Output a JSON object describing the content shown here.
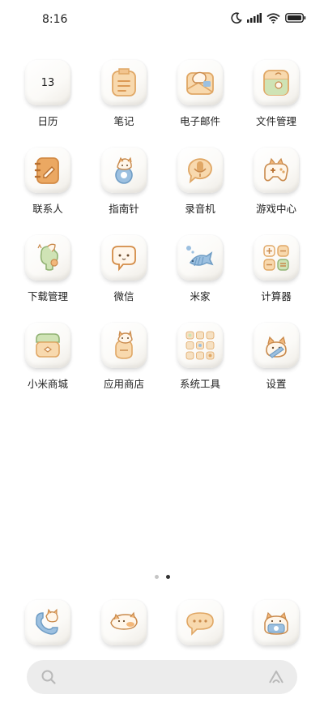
{
  "status_bar": {
    "time": "8:16",
    "icons": [
      "moon-icon",
      "signal-icon",
      "wifi-icon",
      "battery-icon"
    ]
  },
  "apps": [
    {
      "label": "日历",
      "icon": "calendar-icon",
      "date": "13"
    },
    {
      "label": "笔记",
      "icon": "notes-icon"
    },
    {
      "label": "电子邮件",
      "icon": "email-icon"
    },
    {
      "label": "文件管理",
      "icon": "file-manager-icon"
    },
    {
      "label": "联系人",
      "icon": "contacts-icon"
    },
    {
      "label": "指南针",
      "icon": "compass-icon"
    },
    {
      "label": "录音机",
      "icon": "recorder-icon"
    },
    {
      "label": "游戏中心",
      "icon": "game-center-icon"
    },
    {
      "label": "下载管理",
      "icon": "download-manager-icon"
    },
    {
      "label": "微信",
      "icon": "wechat-icon"
    },
    {
      "label": "米家",
      "icon": "mijia-icon"
    },
    {
      "label": "计算器",
      "icon": "calculator-icon"
    },
    {
      "label": "小米商城",
      "icon": "mi-store-icon"
    },
    {
      "label": "应用商店",
      "icon": "app-store-icon"
    },
    {
      "label": "系统工具",
      "icon": "system-tools-folder-icon"
    },
    {
      "label": "设置",
      "icon": "settings-icon"
    }
  ],
  "page_indicator": {
    "pages": 2,
    "current": 2
  },
  "dock": [
    {
      "icon": "phone-icon"
    },
    {
      "icon": "contacts-cat-icon"
    },
    {
      "icon": "messages-icon"
    },
    {
      "icon": "camera-icon"
    }
  ],
  "search": {
    "icon": "search-icon",
    "assistant_icon": "assistant-icon"
  },
  "colors": {
    "accent_orange": "#e8a25a",
    "icon_cream": "#f8e3c4",
    "icon_green": "#cfe3b5",
    "icon_blue": "#9cc0e0"
  }
}
